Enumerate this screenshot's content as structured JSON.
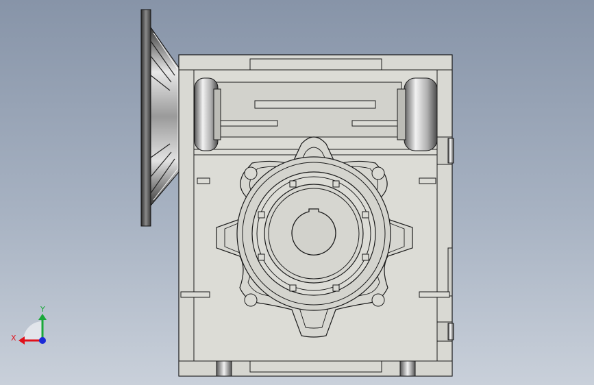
{
  "triad": {
    "x_label": "X",
    "y_label": "Y",
    "x_color": "#e0101a",
    "y_color": "#1aa83a",
    "z_color": "#1a2ad8"
  },
  "model": {
    "body_fill": "#d9d9d3",
    "edge_color": "#1a1a1a",
    "metal_dark": "#6f6f6f",
    "metal_light": "#f4f4f4"
  }
}
